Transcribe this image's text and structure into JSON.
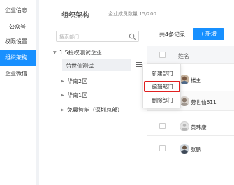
{
  "sidebar": {
    "items": [
      {
        "label": "企业信息"
      },
      {
        "label": "公众号"
      },
      {
        "label": "权限设置"
      },
      {
        "label": "组织架构"
      },
      {
        "label": "企业微信"
      }
    ]
  },
  "header": {
    "title": "组织架构",
    "member_count": "企业成员数量 15/200"
  },
  "search": {
    "placeholder": "搜索部门"
  },
  "tree": {
    "root": "1.5授权测试企业",
    "children": [
      {
        "label": "劳世仙测试"
      },
      {
        "label": "华南2区"
      },
      {
        "label": "华南1区"
      },
      {
        "label": "免晨智能（深圳总部）"
      }
    ]
  },
  "context_menu": {
    "items": [
      {
        "label": "新建部门"
      },
      {
        "label": "编辑部门"
      },
      {
        "label": "删除部门"
      }
    ]
  },
  "table": {
    "record_count": "共4条记录",
    "add_button": "+ 新增",
    "header_name": "姓名",
    "rows": [
      {
        "name": "楼主"
      },
      {
        "name": "劳世仙611"
      },
      {
        "name": "黄玮康"
      },
      {
        "name": "张鹏"
      }
    ]
  },
  "colors": {
    "accent": "#1890ff",
    "highlight": "#e02020"
  }
}
